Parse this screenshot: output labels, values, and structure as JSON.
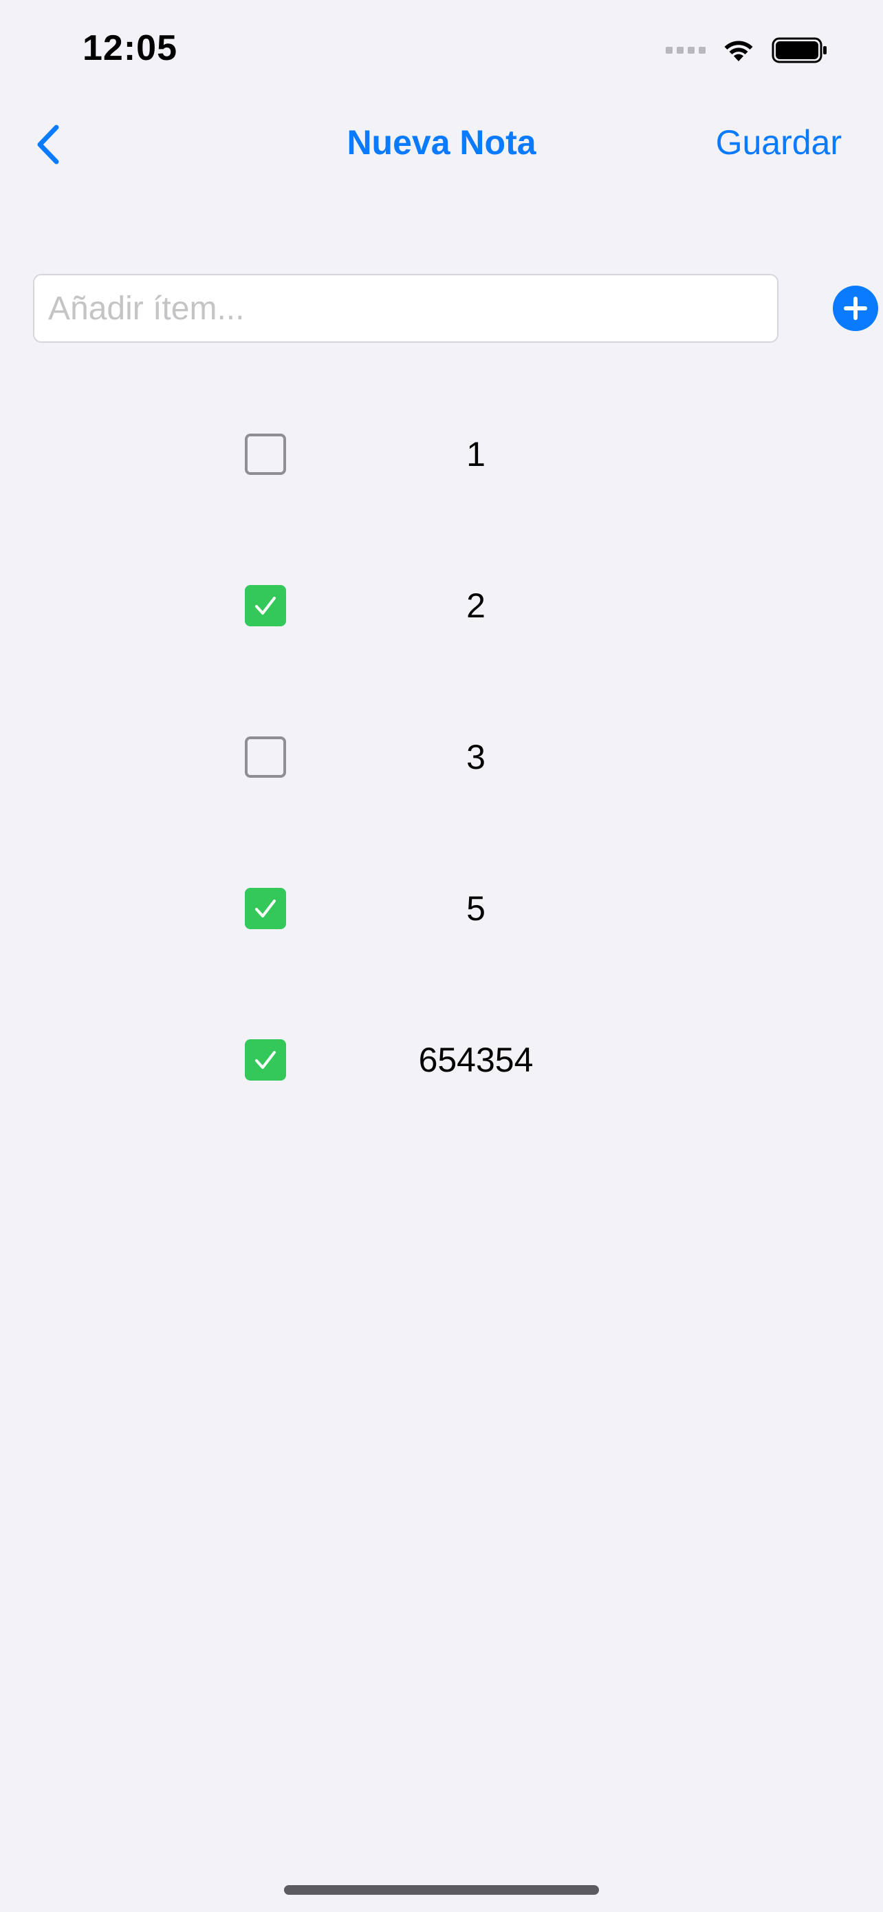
{
  "status_bar": {
    "time": "12:05"
  },
  "nav": {
    "title": "Nueva Nota",
    "save_label": "Guardar",
    "back_icon": "chevron-left-icon"
  },
  "add_item": {
    "placeholder": "Añadir ítem...",
    "value": "",
    "button_icon": "plus-circle-icon"
  },
  "items": [
    {
      "label": "1",
      "checked": false
    },
    {
      "label": "2",
      "checked": true
    },
    {
      "label": "3",
      "checked": false
    },
    {
      "label": "5",
      "checked": true
    },
    {
      "label": "654354",
      "checked": true
    }
  ],
  "colors": {
    "accent": "#0a7aff",
    "checked": "#34c759",
    "unchecked_border": "#8e8e93",
    "background": "#f2f2f7"
  }
}
